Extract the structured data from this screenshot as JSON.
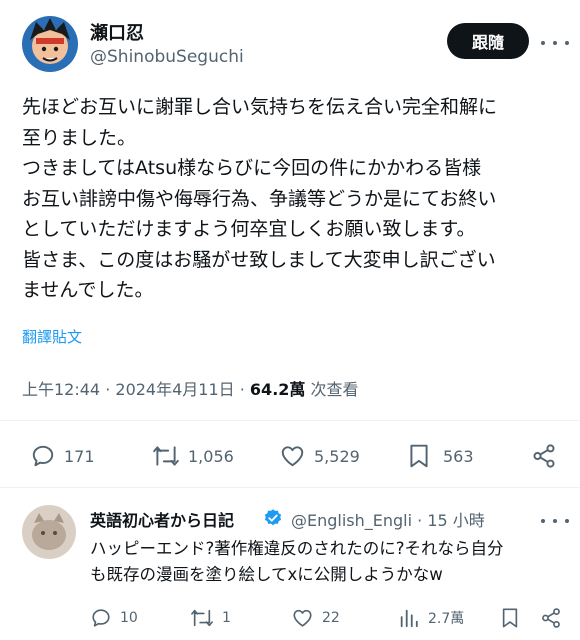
{
  "post": {
    "author_name": "瀬口忍",
    "author_handle": "@ShinobuSeguchi",
    "follow_label": "跟隨",
    "more_icon": "more-horizontal-icon",
    "body_lines": [
      "先ほどお互いに謝罪し合い気持ちを伝え合い完全和解に",
      "至りました。",
      "つきましてはAtsu様ならびに今回の件にかかわる皆様",
      "お互い誹謗中傷や侮辱行為、争議等どうか是にてお終い",
      "としていただけますよう何卒宜しくお願い致します。",
      "皆さま、この度はお騒がせ致しまして大変申し訳ござい",
      "ませんでした。"
    ],
    "translate_label": "翻譯貼文",
    "time": "上午12:44",
    "date": "2024年4月11日",
    "views_count": "64.2萬",
    "views_label": "次查看",
    "actions": {
      "replies": "171",
      "reposts": "1,056",
      "likes": "5,529",
      "bookmarks": "563"
    }
  },
  "reply": {
    "author_name": "英語初心者から日記",
    "author_handle": "@English_Engli",
    "time_ago": "15 小時",
    "body_lines": [
      "ハッピーエンド?著作権違反のされたのに?それなら自分",
      "も既存の漫画を塗り絵してxに公開しようかなw"
    ],
    "actions": {
      "replies": "10",
      "reposts": "1",
      "likes": "22",
      "views": "2.7萬"
    }
  },
  "colors": {
    "text": "#0f1419",
    "secondary": "#536471",
    "link": "#1d9bf0",
    "verified": "#1d9bf0",
    "divider": "#eff3f4"
  }
}
